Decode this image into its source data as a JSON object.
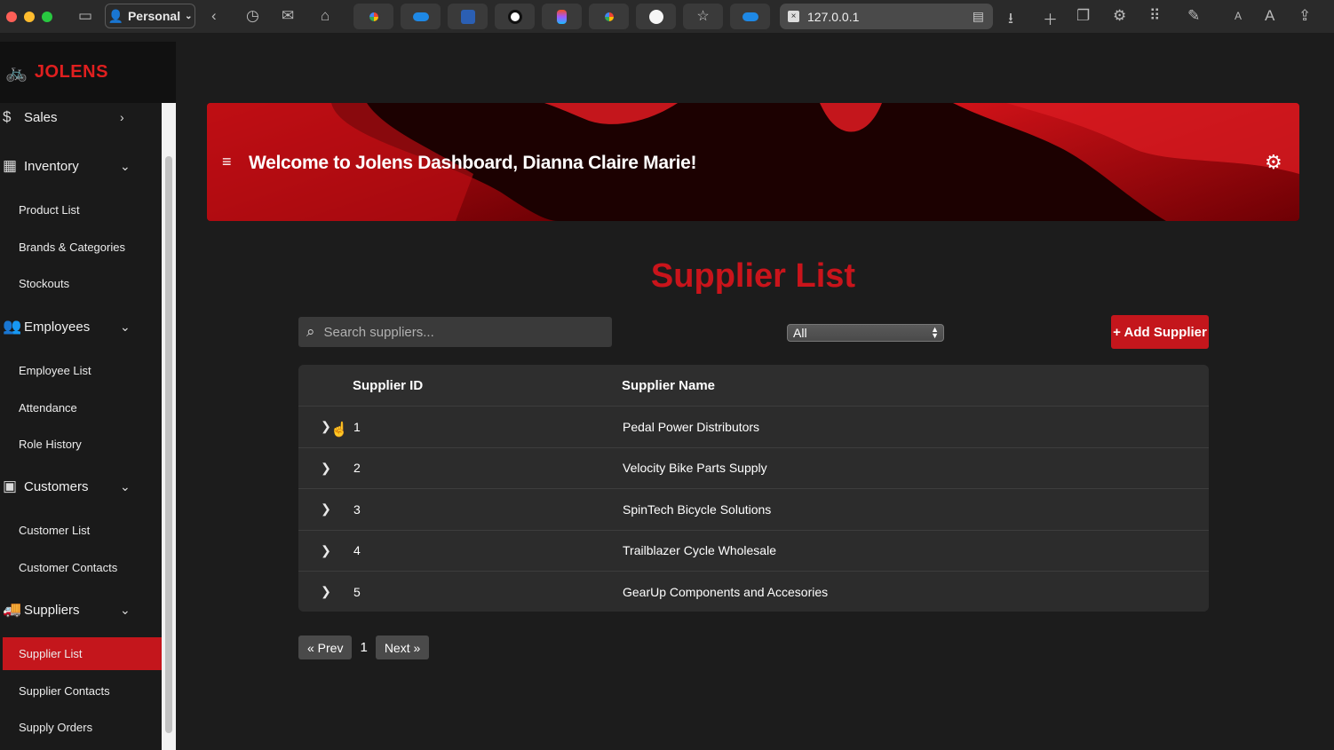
{
  "browser": {
    "profile_label": "Personal",
    "url": "127.0.0.1"
  },
  "brand": {
    "name": "JOLENS",
    "accent": "#c4161c"
  },
  "sidebar": {
    "sections": [
      {
        "label": "Sales",
        "icon": "money-bag-icon"
      },
      {
        "label": "Inventory",
        "icon": "boxes-icon"
      },
      {
        "label": "Employees",
        "icon": "users-icon"
      },
      {
        "label": "Customers",
        "icon": "contact-card-icon"
      },
      {
        "label": "Suppliers",
        "icon": "truck-icon"
      }
    ],
    "items": [
      {
        "label": "Product List"
      },
      {
        "label": "Brands & Categories"
      },
      {
        "label": "Stockouts"
      },
      {
        "label": "Employee List"
      },
      {
        "label": "Attendance"
      },
      {
        "label": "Role History"
      },
      {
        "label": "Customer List"
      },
      {
        "label": "Customer Contacts"
      },
      {
        "label": "Supplier List"
      },
      {
        "label": "Supplier Contacts"
      },
      {
        "label": "Supply Orders"
      }
    ]
  },
  "header": {
    "welcome": "Welcome to Jolens Dashboard, Dianna Claire Marie!"
  },
  "main": {
    "title": "Supplier List",
    "search_placeholder": "Search suppliers...",
    "filter_value": "All",
    "add_button": "+ Add Supplier",
    "table": {
      "headers": [
        "Supplier ID",
        "Supplier Name"
      ],
      "rows": [
        {
          "id": "1",
          "name": "Pedal Power Distributors"
        },
        {
          "id": "2",
          "name": "Velocity Bike Parts Supply"
        },
        {
          "id": "3",
          "name": "SpinTech Bicycle Solutions"
        },
        {
          "id": "4",
          "name": "Trailblazer Cycle Wholesale"
        },
        {
          "id": "5",
          "name": "GearUp Components and Accesories"
        }
      ]
    },
    "pagination": {
      "prev": "« Prev",
      "page": "1",
      "next": "Next »"
    }
  }
}
